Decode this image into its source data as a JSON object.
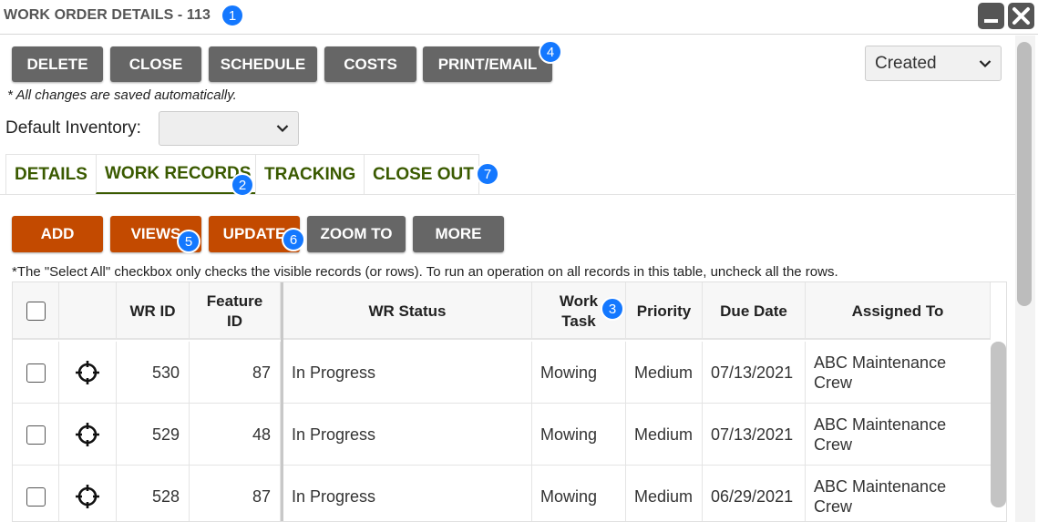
{
  "window": {
    "title": "WORK ORDER DETAILS - 113"
  },
  "toolbar": {
    "delete_label": "DELETE",
    "close_label": "CLOSE",
    "schedule_label": "SCHEDULE",
    "costs_label": "COSTS",
    "print_label": "PRINT/EMAIL",
    "status_value": "Created"
  },
  "autosave_note": "* All changes are saved automatically.",
  "inventory": {
    "label": "Default Inventory:",
    "value": ""
  },
  "tabs": [
    {
      "label": "DETAILS"
    },
    {
      "label": "WORK RECORDS"
    },
    {
      "label": "TRACKING"
    },
    {
      "label": "CLOSE OUT"
    }
  ],
  "actions": {
    "add_label": "ADD",
    "views_label": "VIEWS",
    "update_label": "UPDATE",
    "zoom_label": "ZOOM TO",
    "more_label": "MORE"
  },
  "select_all_note": "*The \"Select All\" checkbox only checks the visible records (or rows). To run an operation on all records in this table, uncheck all the rows.",
  "table": {
    "headers": {
      "wr_id": "WR ID",
      "feature_id": "Feature ID",
      "wr_status": "WR Status",
      "work_task": "Work Task",
      "priority": "Priority",
      "due_date": "Due Date",
      "assigned_to": "Assigned To"
    },
    "rows": [
      {
        "wr_id": "530",
        "feature_id": "87",
        "wr_status": "In Progress",
        "work_task": "Mowing",
        "priority": "Medium",
        "due_date": "07/13/2021",
        "assigned_to": "ABC Maintenance Crew"
      },
      {
        "wr_id": "529",
        "feature_id": "48",
        "wr_status": "In Progress",
        "work_task": "Mowing",
        "priority": "Medium",
        "due_date": "07/13/2021",
        "assigned_to": "ABC Maintenance Crew"
      },
      {
        "wr_id": "528",
        "feature_id": "87",
        "wr_status": "In Progress",
        "work_task": "Mowing",
        "priority": "Medium",
        "due_date": "06/29/2021",
        "assigned_to": "ABC Maintenance Crew"
      }
    ]
  },
  "callouts": [
    "1",
    "2",
    "3",
    "4",
    "5",
    "6",
    "7"
  ],
  "colors": {
    "accent_orange": "#c34a00",
    "button_gray": "#666666",
    "tab_green": "#3a5a00",
    "callout_blue": "#1478ff"
  },
  "icons": {
    "row_locate": "crosshair-icon",
    "window_minimize": "minimize-icon",
    "window_close": "close-icon",
    "dropdown": "chevron-down-icon"
  }
}
